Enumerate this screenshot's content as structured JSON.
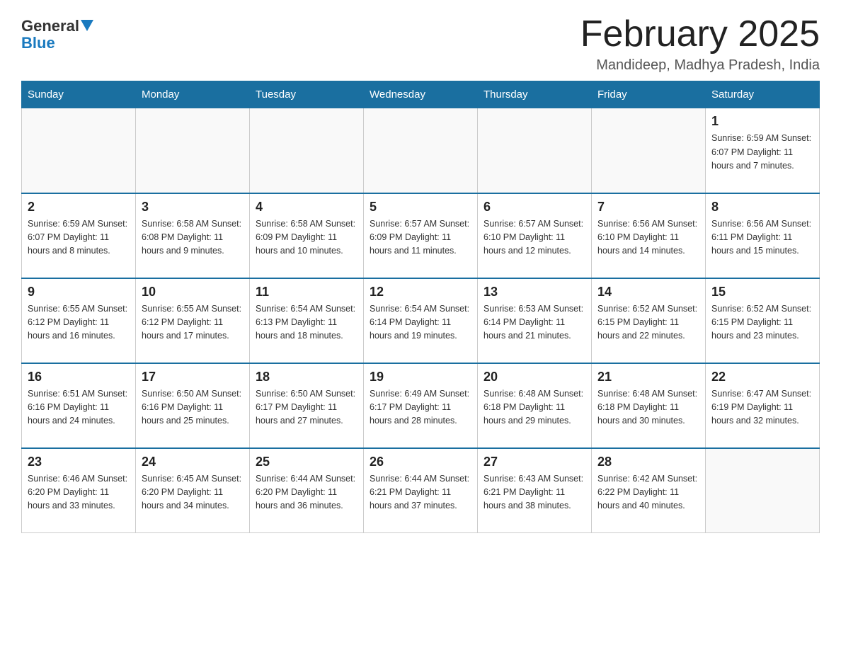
{
  "header": {
    "logo": {
      "general": "General",
      "blue": "Blue",
      "triangle": "▲"
    },
    "title": "February 2025",
    "location": "Mandideep, Madhya Pradesh, India"
  },
  "days_of_week": [
    "Sunday",
    "Monday",
    "Tuesday",
    "Wednesday",
    "Thursday",
    "Friday",
    "Saturday"
  ],
  "weeks": [
    {
      "days": [
        {
          "num": "",
          "info": ""
        },
        {
          "num": "",
          "info": ""
        },
        {
          "num": "",
          "info": ""
        },
        {
          "num": "",
          "info": ""
        },
        {
          "num": "",
          "info": ""
        },
        {
          "num": "",
          "info": ""
        },
        {
          "num": "1",
          "info": "Sunrise: 6:59 AM\nSunset: 6:07 PM\nDaylight: 11 hours and 7 minutes."
        }
      ]
    },
    {
      "days": [
        {
          "num": "2",
          "info": "Sunrise: 6:59 AM\nSunset: 6:07 PM\nDaylight: 11 hours and 8 minutes."
        },
        {
          "num": "3",
          "info": "Sunrise: 6:58 AM\nSunset: 6:08 PM\nDaylight: 11 hours and 9 minutes."
        },
        {
          "num": "4",
          "info": "Sunrise: 6:58 AM\nSunset: 6:09 PM\nDaylight: 11 hours and 10 minutes."
        },
        {
          "num": "5",
          "info": "Sunrise: 6:57 AM\nSunset: 6:09 PM\nDaylight: 11 hours and 11 minutes."
        },
        {
          "num": "6",
          "info": "Sunrise: 6:57 AM\nSunset: 6:10 PM\nDaylight: 11 hours and 12 minutes."
        },
        {
          "num": "7",
          "info": "Sunrise: 6:56 AM\nSunset: 6:10 PM\nDaylight: 11 hours and 14 minutes."
        },
        {
          "num": "8",
          "info": "Sunrise: 6:56 AM\nSunset: 6:11 PM\nDaylight: 11 hours and 15 minutes."
        }
      ]
    },
    {
      "days": [
        {
          "num": "9",
          "info": "Sunrise: 6:55 AM\nSunset: 6:12 PM\nDaylight: 11 hours and 16 minutes."
        },
        {
          "num": "10",
          "info": "Sunrise: 6:55 AM\nSunset: 6:12 PM\nDaylight: 11 hours and 17 minutes."
        },
        {
          "num": "11",
          "info": "Sunrise: 6:54 AM\nSunset: 6:13 PM\nDaylight: 11 hours and 18 minutes."
        },
        {
          "num": "12",
          "info": "Sunrise: 6:54 AM\nSunset: 6:14 PM\nDaylight: 11 hours and 19 minutes."
        },
        {
          "num": "13",
          "info": "Sunrise: 6:53 AM\nSunset: 6:14 PM\nDaylight: 11 hours and 21 minutes."
        },
        {
          "num": "14",
          "info": "Sunrise: 6:52 AM\nSunset: 6:15 PM\nDaylight: 11 hours and 22 minutes."
        },
        {
          "num": "15",
          "info": "Sunrise: 6:52 AM\nSunset: 6:15 PM\nDaylight: 11 hours and 23 minutes."
        }
      ]
    },
    {
      "days": [
        {
          "num": "16",
          "info": "Sunrise: 6:51 AM\nSunset: 6:16 PM\nDaylight: 11 hours and 24 minutes."
        },
        {
          "num": "17",
          "info": "Sunrise: 6:50 AM\nSunset: 6:16 PM\nDaylight: 11 hours and 25 minutes."
        },
        {
          "num": "18",
          "info": "Sunrise: 6:50 AM\nSunset: 6:17 PM\nDaylight: 11 hours and 27 minutes."
        },
        {
          "num": "19",
          "info": "Sunrise: 6:49 AM\nSunset: 6:17 PM\nDaylight: 11 hours and 28 minutes."
        },
        {
          "num": "20",
          "info": "Sunrise: 6:48 AM\nSunset: 6:18 PM\nDaylight: 11 hours and 29 minutes."
        },
        {
          "num": "21",
          "info": "Sunrise: 6:48 AM\nSunset: 6:18 PM\nDaylight: 11 hours and 30 minutes."
        },
        {
          "num": "22",
          "info": "Sunrise: 6:47 AM\nSunset: 6:19 PM\nDaylight: 11 hours and 32 minutes."
        }
      ]
    },
    {
      "days": [
        {
          "num": "23",
          "info": "Sunrise: 6:46 AM\nSunset: 6:20 PM\nDaylight: 11 hours and 33 minutes."
        },
        {
          "num": "24",
          "info": "Sunrise: 6:45 AM\nSunset: 6:20 PM\nDaylight: 11 hours and 34 minutes."
        },
        {
          "num": "25",
          "info": "Sunrise: 6:44 AM\nSunset: 6:20 PM\nDaylight: 11 hours and 36 minutes."
        },
        {
          "num": "26",
          "info": "Sunrise: 6:44 AM\nSunset: 6:21 PM\nDaylight: 11 hours and 37 minutes."
        },
        {
          "num": "27",
          "info": "Sunrise: 6:43 AM\nSunset: 6:21 PM\nDaylight: 11 hours and 38 minutes."
        },
        {
          "num": "28",
          "info": "Sunrise: 6:42 AM\nSunset: 6:22 PM\nDaylight: 11 hours and 40 minutes."
        },
        {
          "num": "",
          "info": ""
        }
      ]
    }
  ]
}
